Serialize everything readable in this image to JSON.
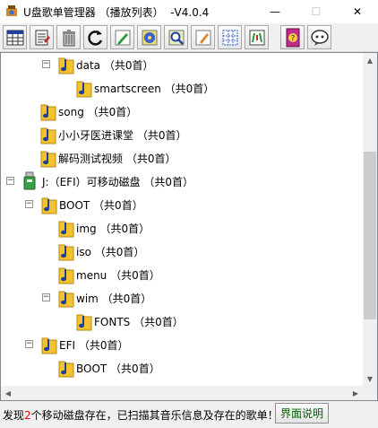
{
  "window": {
    "title": "U盘歌单管理器 （播放列表）  -V4.0.4",
    "minimize_glyph": "—",
    "maximize_glyph": "☐",
    "close_glyph": "✕"
  },
  "toolbar": {
    "buttons": [
      {
        "icon": "playlist-grid-icon"
      },
      {
        "icon": "notes-edit-icon"
      },
      {
        "icon": "delete-trash-icon"
      },
      {
        "icon": "refresh-icon"
      },
      {
        "icon": "pen-edit-icon"
      },
      {
        "icon": "disc-scan-icon"
      },
      {
        "icon": "magnify-scan-icon"
      },
      {
        "icon": "rename-pencil-icon"
      },
      {
        "icon": "grid-select-icon"
      },
      {
        "icon": "export-list-icon"
      },
      {
        "icon": "help-book-icon"
      },
      {
        "icon": "feedback-chat-icon"
      }
    ]
  },
  "tree": {
    "nodes": [
      {
        "label": "data  （共0首）",
        "expander": "−"
      },
      {
        "label": "smartscreen  （共0首）"
      },
      {
        "label": "song  （共0首）"
      },
      {
        "label": "小小牙医进课堂  （共0首）"
      },
      {
        "label": "解码测试视频  （共0首）"
      },
      {
        "label": "J:（EFI）可移动磁盘  （共0首）",
        "expander": "−"
      },
      {
        "label": "BOOT  （共0首）",
        "expander": "−"
      },
      {
        "label": "img  （共0首）"
      },
      {
        "label": "iso  （共0首）"
      },
      {
        "label": "menu  （共0首）"
      },
      {
        "label": "wim  （共0首）",
        "expander": "−"
      },
      {
        "label": "FONTS  （共0首）"
      },
      {
        "label": "EFI  （共0首）",
        "expander": "−"
      },
      {
        "label": "BOOT  （共0首）"
      }
    ]
  },
  "status": {
    "prefix": "发现",
    "count": "2",
    "suffix": "个移动磁盘存在，已扫描其音乐信息及存在的歌单！",
    "help_button": "界面说明"
  },
  "colors": {
    "folder": "#f2c32e",
    "note": "#1f3f9a",
    "status_count": "#ff0000",
    "help_text": "#006400"
  }
}
